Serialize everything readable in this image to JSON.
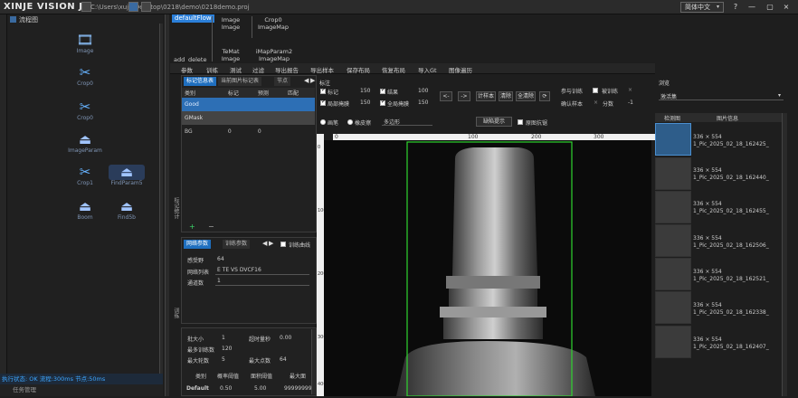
{
  "app": {
    "title": "XINJE VISION J",
    "path": "C:\\Users\\xujh\\Desktop\\0218\\demo\\0218demo.proj",
    "lang": "简体中文",
    "win_help": "?",
    "win_min": "—",
    "win_close": "×"
  },
  "flow": {
    "title": "流程图",
    "nodes": [
      {
        "label": "Image",
        "icon": "film"
      },
      {
        "label": "Crop0",
        "icon": "scissors"
      },
      {
        "label": "Crop0",
        "icon": "scissors"
      },
      {
        "label": "ImageParam",
        "icon": "bell"
      },
      {
        "label": "Crop1",
        "icon": "scissors"
      },
      {
        "label": "FindParam5",
        "icon": "bell"
      },
      {
        "label": "Boom",
        "icon": "bell"
      },
      {
        "label": "Find5b",
        "icon": "bell"
      }
    ]
  },
  "status": {
    "run": "执行状态: OK  流程:300ms  节点:50ms",
    "task": "任务管理"
  },
  "canvas": {
    "badge": "defaultFlow",
    "items": [
      {
        "l1": "Image",
        "l2": "Image"
      },
      {
        "l1": "Crop0",
        "l2": "ImageMap"
      },
      {
        "l1": "TeMat",
        "l2": "Image"
      },
      {
        "l1": "iMapParam2",
        "l2": "ImageMap"
      }
    ],
    "add": "add",
    "delete": "delete"
  },
  "toolbar": [
    "参数",
    "训练",
    "测试",
    "过滤",
    "导出报告",
    "导出样本",
    "保存布局",
    "恢复布局",
    "导入Gt",
    "图像遍历"
  ],
  "label_panel": {
    "tabs": [
      "标记信息表",
      "当前图片标记表",
      "节点"
    ],
    "headers": [
      "类别",
      "标记",
      "预测",
      "匹配"
    ],
    "rows": [
      {
        "c": "Good",
        "a": "",
        "b": "",
        "d": ""
      },
      {
        "c": "GMask",
        "a": "",
        "b": "",
        "d": ""
      },
      {
        "c": "BG",
        "a": "0",
        "b": "0",
        "d": ""
      }
    ],
    "side_label": "标记统计"
  },
  "net_panel": {
    "tabs": [
      "网络参数",
      "训练参数"
    ],
    "curve": "训练曲线",
    "fields": [
      {
        "k": "感受野",
        "v": "64"
      },
      {
        "k": "网络列表",
        "v": "E TE VS DVCF16"
      },
      {
        "k": "通道数",
        "v": "1"
      }
    ],
    "side_label": "训练"
  },
  "param_panel": {
    "rows": [
      {
        "k": "批大小",
        "v": "1",
        "k2": "超时量秒",
        "v2": "0.00"
      },
      {
        "k": "最多训练数",
        "v": "120",
        "k2": "",
        "v2": ""
      },
      {
        "k": "最大轮数",
        "v": "5",
        "k2": "最大点数",
        "v2": "64"
      }
    ],
    "headers": [
      "类别",
      "概率阈值",
      "面积阈值",
      "最大面"
    ],
    "default_row": [
      "Default",
      "0.50",
      "5.00",
      "99999999"
    ]
  },
  "marking": {
    "title": "标注",
    "checks": [
      {
        "label": "标记",
        "val": "150",
        "on": true
      },
      {
        "label": "结果",
        "val": "100",
        "on": true
      },
      {
        "label": "局部掩膜",
        "val": "150",
        "on": true
      },
      {
        "label": "全局掩膜",
        "val": "150",
        "on": true
      }
    ],
    "buttons": [
      "<-",
      "->",
      "计样本",
      "清除",
      "全清除"
    ],
    "options": [
      {
        "label": "参与训练",
        "on": false
      },
      {
        "label": "被训练",
        "on": false
      }
    ],
    "sample": "确认样本",
    "score": "分数",
    "score_val": "-1",
    "tools": [
      "画笔",
      "橡皮擦",
      "多边形"
    ],
    "hint": "缺陷提示",
    "bg": "原图抗锯"
  },
  "ruler": {
    "top": [
      "0",
      "100",
      "200",
      "300"
    ],
    "left": [
      "0",
      "100",
      "200",
      "300",
      "400"
    ]
  },
  "right": {
    "title": "浏览",
    "select": "激活集",
    "headers": [
      "检测图",
      "图片信息"
    ],
    "thumbs": [
      {
        "size": "336 × 554",
        "name": "1_Pic_2025_02_18_162425_"
      },
      {
        "size": "336 × 554",
        "name": "1_Pic_2025_02_18_162440_"
      },
      {
        "size": "336 × 554",
        "name": "1_Pic_2025_02_18_162455_"
      },
      {
        "size": "336 × 554",
        "name": "1_Pic_2025_02_18_162506_"
      },
      {
        "size": "336 × 554",
        "name": "1_Pic_2025_02_18_162521_"
      },
      {
        "size": "336 × 554",
        "name": "1_Pic_2025_02_18_162338_"
      },
      {
        "size": "336 × 554",
        "name": "1_Pic_2025_02_18_162407_"
      }
    ]
  },
  "colors": {
    "accent": "#2b7fd9",
    "roi": "#2fd62f"
  }
}
